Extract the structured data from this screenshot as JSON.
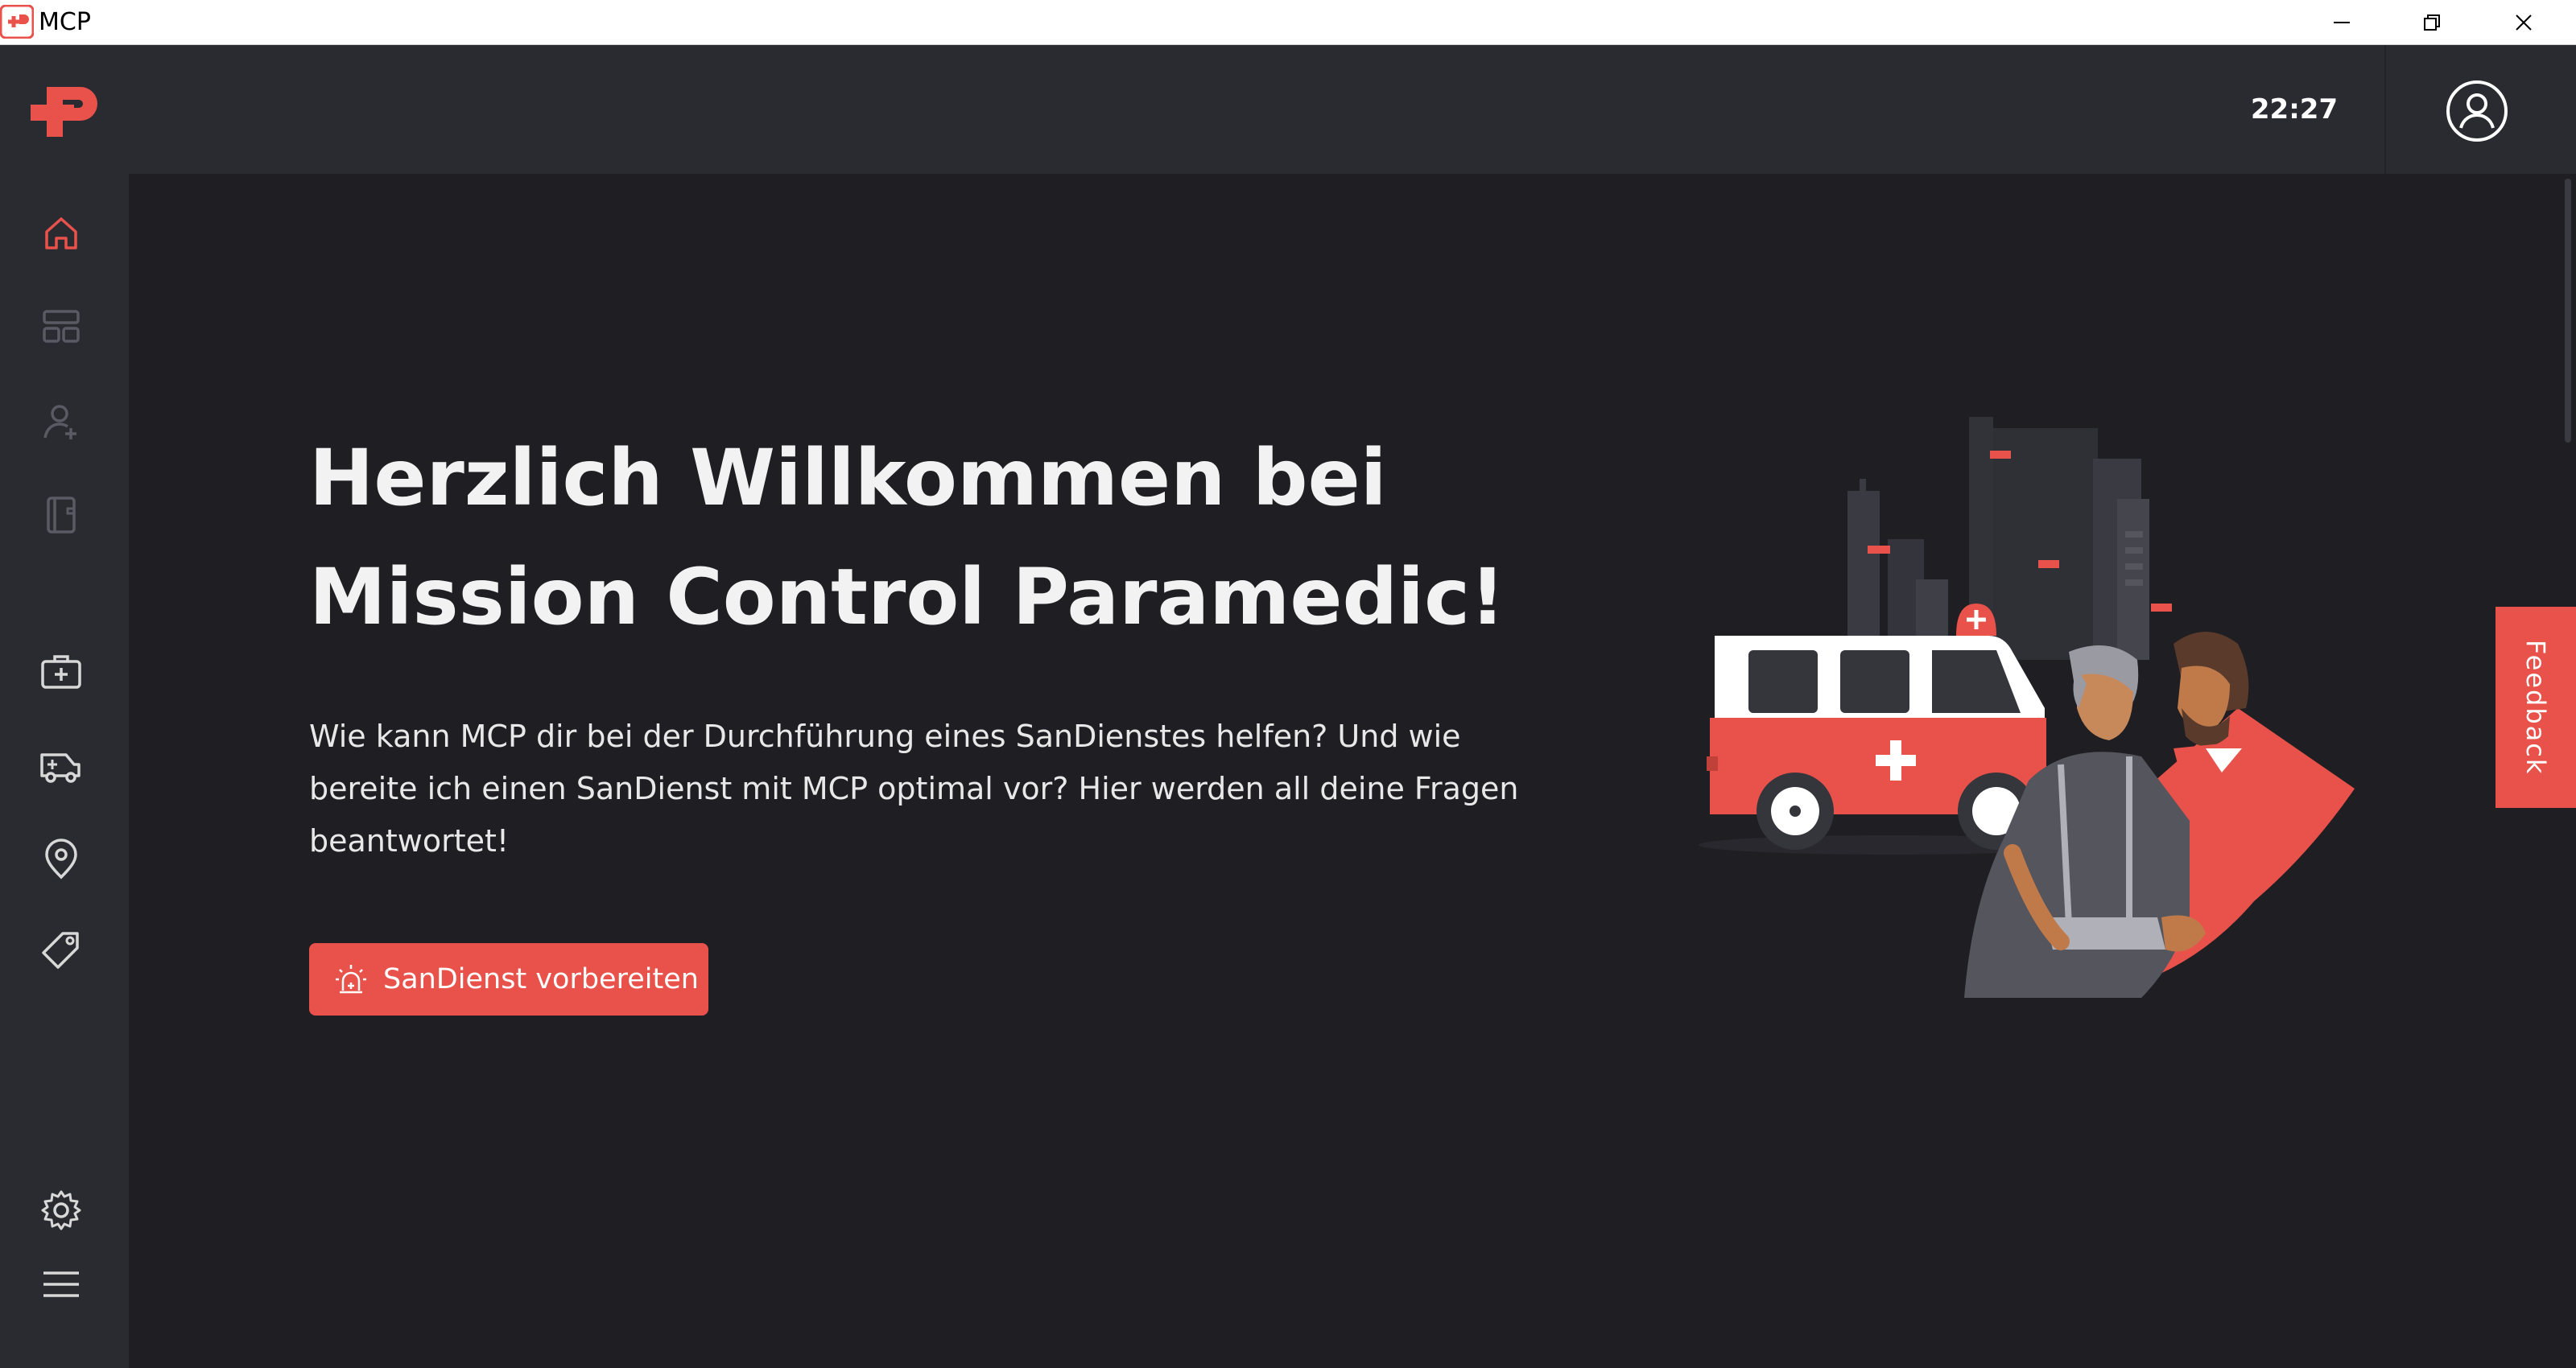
{
  "window": {
    "title": "MCP",
    "controls": [
      "minimize-icon",
      "restore-icon",
      "close-icon"
    ]
  },
  "header": {
    "logo": "mcp-logo",
    "time": "22:27",
    "profile_icon": "user-circle-icon"
  },
  "sidebar": {
    "items": [
      {
        "icon": "home-icon",
        "active": true
      },
      {
        "icon": "dashboard-icon",
        "active": false
      },
      {
        "icon": "add-user-icon",
        "active": false
      },
      {
        "icon": "book-icon",
        "active": false
      },
      {
        "icon": "medical-kit-icon",
        "active": false
      },
      {
        "icon": "ambulance-icon",
        "active": false
      },
      {
        "icon": "location-pin-icon",
        "active": false
      },
      {
        "icon": "tag-icon",
        "active": false
      },
      {
        "icon": "settings-icon",
        "active": false
      },
      {
        "icon": "menu-icon",
        "active": false
      }
    ]
  },
  "main": {
    "headline_line1": "Herzlich Willkommen bei",
    "headline_line2": "Mission Control Paramedic!",
    "intro": "Wie kann MCP dir bei der Durchführung eines SanDienstes helfen? Und wie bereite ich einen SanDienst mit MCP optimal vor? Hier werden all deine Fragen beantwortet!",
    "cta_label": "SanDienst vorbereiten",
    "cta_icon": "siren-icon"
  },
  "feedback": {
    "label": "Feedback"
  },
  "colors": {
    "accent": "#e8524a",
    "background": "#1e1e23",
    "header_background": "#2a2a31",
    "icon_inactive": "#5a5a64",
    "icon_default": "#d8d8d8"
  }
}
